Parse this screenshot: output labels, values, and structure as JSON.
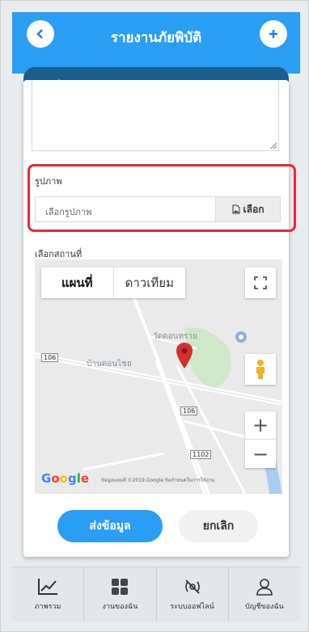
{
  "header": {
    "title": "รายงานภัยพิบัติ"
  },
  "background": {
    "bar_text": "ประจำมาน"
  },
  "photo": {
    "label": "รูปภาพ",
    "placeholder": "เลือกรูปภาพ",
    "choose_label": "เลือก"
  },
  "location": {
    "label": "เลือกสถานที่",
    "map_tab": "แผนที่",
    "satellite_tab": "ดาวเทียม",
    "place_temple": "วัดดอนทราย",
    "place_village": "บ้านดอนไชย",
    "road_106_a": "106",
    "road_106_b": "106",
    "road_1102": "1102",
    "google": "Google",
    "attribution": "ข้อมูลแผนที่ ©2019 Google   ข้อกำหนดในการใช้งาน"
  },
  "actions": {
    "send": "ส่งข้อมูล",
    "cancel": "ยกเลิก"
  },
  "nav": {
    "items": [
      {
        "label": "ภาพรวม",
        "icon": "chart-icon"
      },
      {
        "label": "งานของฉัน",
        "icon": "grid-icon"
      },
      {
        "label": "ระบบออฟไลน์",
        "icon": "offline-icon"
      },
      {
        "label": "บัญชีของฉัน",
        "icon": "user-icon"
      }
    ]
  },
  "colors": {
    "primary": "#2a9df4",
    "highlight": "#e8283b",
    "pin": "#d32f2f"
  }
}
